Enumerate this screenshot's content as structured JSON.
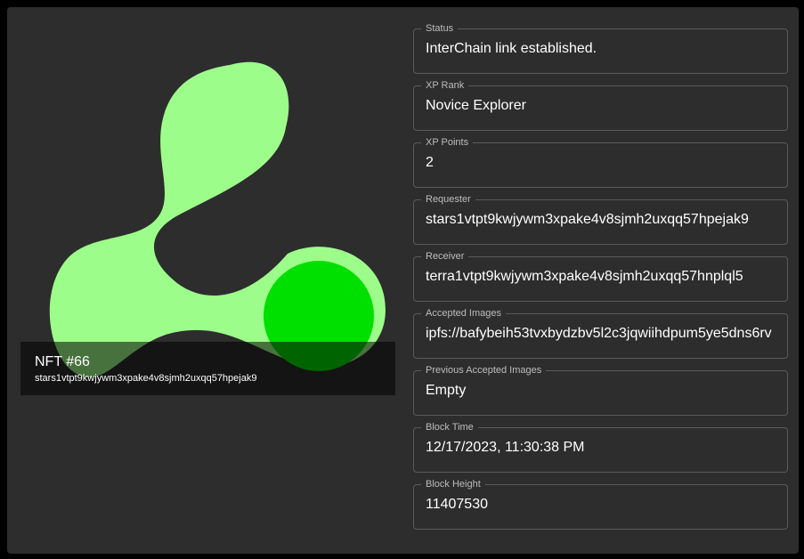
{
  "nft": {
    "title": "NFT #66",
    "owner": "stars1vtpt9kwjywm3xpake4v8sjmh2uxqq57hpejak9",
    "image": "nft-logo-icon",
    "colors": {
      "shape": "#9dfd8a",
      "circle": "#00e000",
      "background": "#2d2d2d"
    }
  },
  "fields": [
    {
      "label": "Status",
      "value": "InterChain link established."
    },
    {
      "label": "XP Rank",
      "value": "Novice Explorer"
    },
    {
      "label": "XP Points",
      "value": "2"
    },
    {
      "label": "Requester",
      "value": "stars1vtpt9kwjywm3xpake4v8sjmh2uxqq57hpejak9"
    },
    {
      "label": "Receiver",
      "value": "terra1vtpt9kwjywm3xpake4v8sjmh2uxqq57hnplql5"
    },
    {
      "label": "Accepted Images",
      "value": "ipfs://bafybeih53tvxbydzbv5l2c3jqwiihdpum5ye5dns6rv"
    },
    {
      "label": "Previous Accepted Images",
      "value": "Empty"
    },
    {
      "label": "Block Time",
      "value": "12/17/2023, 11:30:38 PM"
    },
    {
      "label": "Block Height",
      "value": "11407530"
    }
  ]
}
